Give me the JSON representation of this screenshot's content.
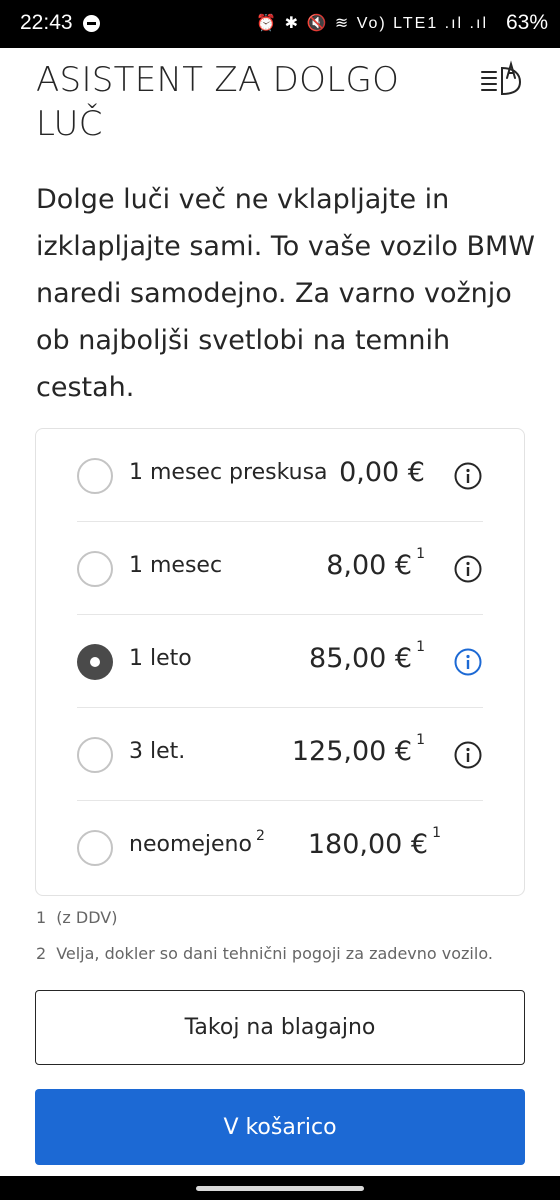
{
  "status_bar": {
    "time": "22:43",
    "indicators": "⏰ ✱ 🔇 ≋ Vo) LTE1 .ıl .ıl",
    "battery": "63%"
  },
  "page": {
    "title": "ASISTENT ZA DOLGO LUČ",
    "title_icon": "high-beam-assistant-icon",
    "intro": "Dolge luči več ne vklapljajte in izklapljajte sami. To vaše vozilo BMW naredi samodejno. Za varno vožnjo ob najboljši svetlobi na temnih cestah."
  },
  "options": [
    {
      "label": "1 mesec preskusa",
      "label_sup": "",
      "price": "0,00 €",
      "price_sup": "",
      "selected": false,
      "info": true
    },
    {
      "label": "1 mesec",
      "label_sup": "",
      "price": "8,00 €",
      "price_sup": "1",
      "selected": false,
      "info": true
    },
    {
      "label": "1 leto",
      "label_sup": "",
      "price": "85,00 €",
      "price_sup": "1",
      "selected": true,
      "info": true
    },
    {
      "label": "3 let.",
      "label_sup": "",
      "price": "125,00 €",
      "price_sup": "1",
      "selected": false,
      "info": true
    },
    {
      "label": "neomejeno",
      "label_sup": "2",
      "price": "180,00 €",
      "price_sup": "1",
      "selected": false,
      "info": false
    }
  ],
  "footnotes": [
    {
      "num": "1",
      "text": "(z DDV)"
    },
    {
      "num": "2",
      "text": "Velja, dokler so dani tehnični pogoji za zadevno vozilo."
    }
  ],
  "buttons": {
    "checkout": "Takoj na blagajno",
    "cart": "V košarico"
  },
  "colors": {
    "accent": "#1c69d4",
    "text": "#262626",
    "info_selected": "#1c69d4",
    "info_default": "#262626"
  }
}
